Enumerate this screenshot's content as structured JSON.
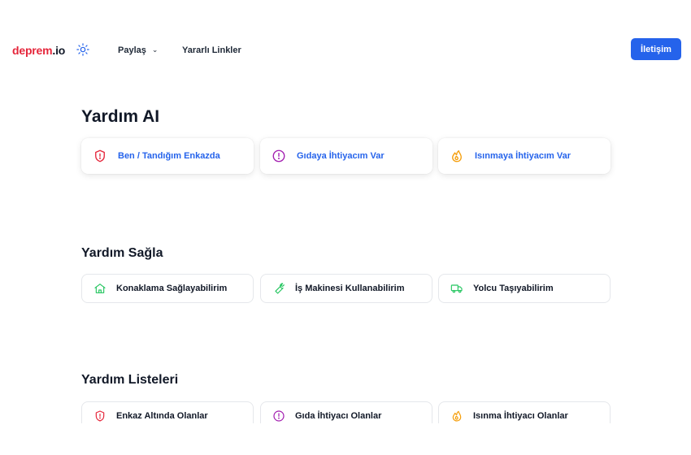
{
  "header": {
    "brand_main": "deprem",
    "brand_suffix": ".io",
    "theme_icon": "sun-icon",
    "share_label": "Paylaş",
    "useful_links_label": "Yararlı Linkler",
    "contact_label": "İletişim",
    "accent_color": "#2563eb",
    "brand_color": "#e5263b"
  },
  "ai_section": {
    "title": "Yardım AI",
    "cards": [
      {
        "label": "Ben / Tandığım Enkazda",
        "icon": "shield-alert-icon",
        "color": "#e5263b"
      },
      {
        "label": "Gıdaya İhtiyacım Var",
        "icon": "alert-circle-icon",
        "color": "#a21caf"
      },
      {
        "label": "Isınmaya İhtiyacım Var",
        "icon": "fire-icon",
        "color": "#f59e0b"
      }
    ]
  },
  "help_section": {
    "title": "Yardım Sağla",
    "cards": [
      {
        "label": "Konaklama Sağlayabilirim",
        "icon": "home-icon",
        "color": "#22c55e"
      },
      {
        "label": "İş Makinesi Kullanabilirim",
        "icon": "wrench-icon",
        "color": "#22c55e"
      },
      {
        "label": "Yolcu Taşıyabilirim",
        "icon": "truck-icon",
        "color": "#22c55e"
      }
    ]
  },
  "lists_section": {
    "title": "Yardım Listeleri",
    "cards": [
      {
        "label": "Enkaz Altında Olanlar",
        "icon": "shield-alert-icon",
        "color": "#e5263b"
      },
      {
        "label": "Gıda İhtiyacı Olanlar",
        "icon": "alert-circle-icon",
        "color": "#a21caf"
      },
      {
        "label": "Isınma İhtiyacı Olanlar",
        "icon": "fire-icon",
        "color": "#f59e0b"
      }
    ]
  }
}
